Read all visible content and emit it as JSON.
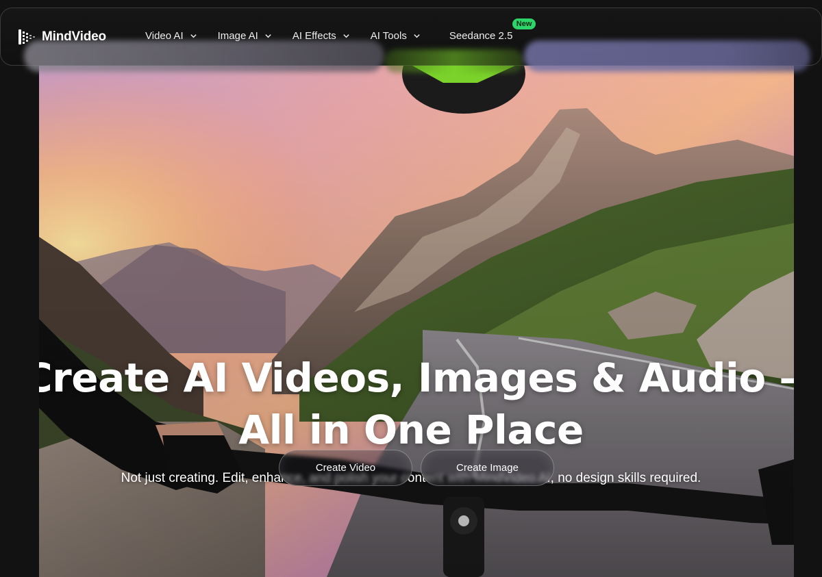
{
  "brand": {
    "name": "MindVideo"
  },
  "nav": {
    "items": [
      {
        "label": "Video AI",
        "has_dropdown": true
      },
      {
        "label": "Image AI",
        "has_dropdown": true
      },
      {
        "label": "AI Effects",
        "has_dropdown": true
      },
      {
        "label": "AI Tools",
        "has_dropdown": true
      },
      {
        "label": "Seedance 2.5",
        "has_dropdown": false,
        "badge": "New"
      }
    ]
  },
  "hero": {
    "title_line1": "Create AI Videos, Images & Audio –",
    "title_line2": "All in One Place",
    "subtitle": "Not just creating. Edit, enhance, and polish your content with MindVideo AI, no design skills required.",
    "cta_primary": "Create Video",
    "cta_secondary": "Create Image"
  },
  "colors": {
    "background": "#121212",
    "badge": "#2dd46a",
    "text": "#ffffff"
  },
  "icons": [
    "logo-mark-icon",
    "chevron-down-icon"
  ]
}
